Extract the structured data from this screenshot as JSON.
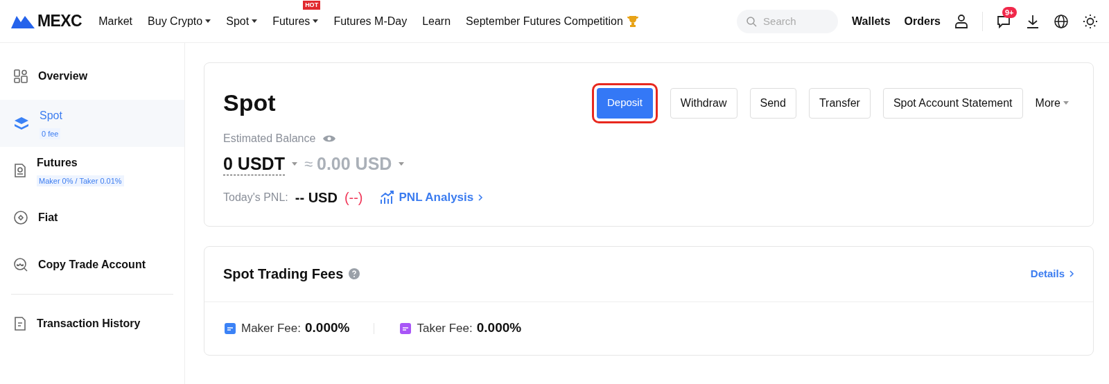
{
  "header": {
    "logo": "MEXC",
    "nav": [
      {
        "label": "Market",
        "dropdown": false
      },
      {
        "label": "Buy Crypto",
        "dropdown": true
      },
      {
        "label": "Spot",
        "dropdown": true
      },
      {
        "label": "Futures",
        "dropdown": true,
        "badge": "HOT"
      },
      {
        "label": "Futures M-Day",
        "dropdown": false
      },
      {
        "label": "Learn",
        "dropdown": false
      },
      {
        "label": "September Futures Competition",
        "dropdown": false
      }
    ],
    "search": {
      "placeholder": "Search"
    },
    "links": [
      "Wallets",
      "Orders"
    ],
    "notification_count": "9+"
  },
  "sidebar": {
    "items": [
      {
        "label": "Overview",
        "selected": false
      },
      {
        "label": "Spot",
        "selected": true,
        "tag": "0 fee"
      },
      {
        "label": "Futures",
        "selected": false,
        "tag": "Maker 0% / Taker 0.01%"
      },
      {
        "label": "Fiat",
        "selected": false
      },
      {
        "label": "Copy Trade Account",
        "selected": false
      },
      {
        "label": "Transaction History",
        "selected": false,
        "divider_before": true
      }
    ]
  },
  "account": {
    "title": "Spot",
    "actions": [
      {
        "label": "Deposit",
        "kind": "primary",
        "highlighted": true
      },
      {
        "label": "Withdraw",
        "kind": "outline",
        "highlighted": false
      },
      {
        "label": "Send",
        "kind": "outline",
        "highlighted": false
      },
      {
        "label": "Transfer",
        "kind": "outline",
        "highlighted": false
      },
      {
        "label": "Spot Account Statement",
        "kind": "outline",
        "highlighted": false
      },
      {
        "label": "More",
        "kind": "menu",
        "highlighted": false
      }
    ],
    "balance_label": "Estimated Balance",
    "balance": "0 USDT",
    "approx_sign": "≈",
    "approx": "0.00 USD",
    "pnl_label": "Today's PNL:",
    "pnl_value": "-- USD",
    "pnl_change": "(--)",
    "pnl_link": "PNL Analysis"
  },
  "fees": {
    "title": "Spot Trading Fees",
    "details": "Details",
    "items": [
      {
        "label": "Maker Fee:",
        "value": "0.000%",
        "color": "#3b82f6"
      },
      {
        "label": "Taker Fee:",
        "value": "0.000%",
        "color": "#a855f7"
      }
    ]
  }
}
